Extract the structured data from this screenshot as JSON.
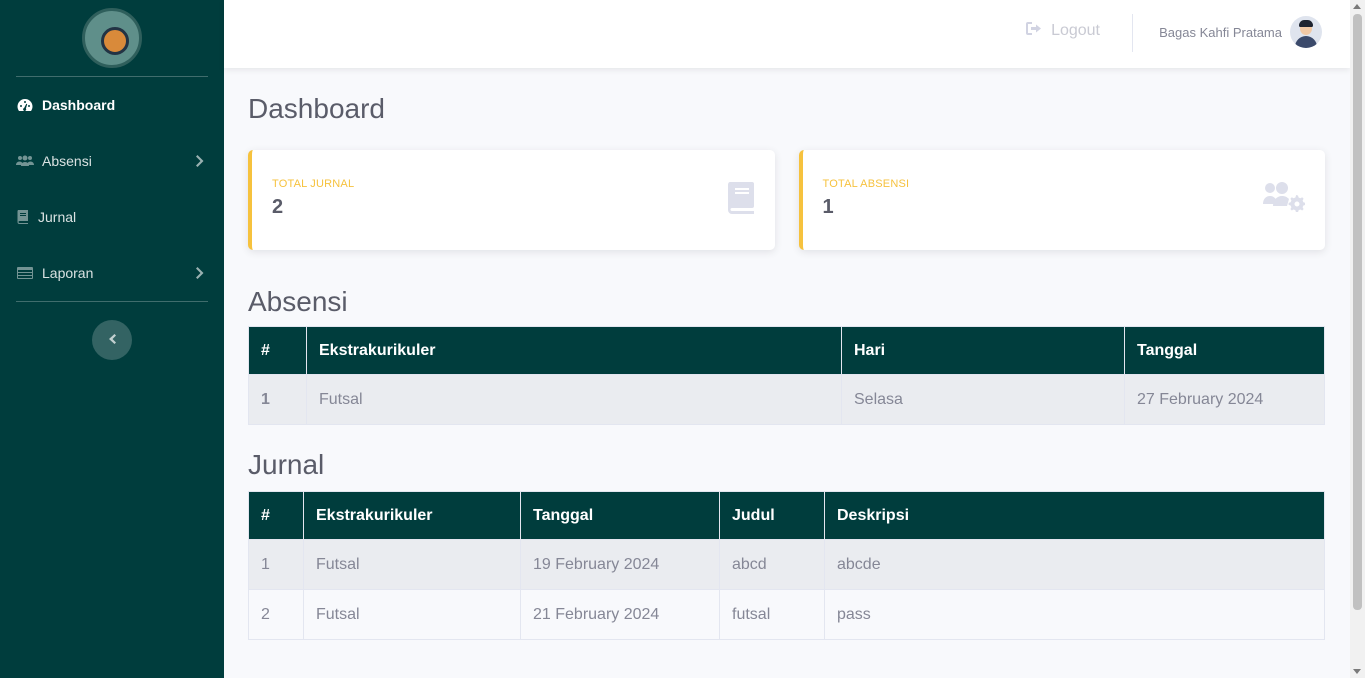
{
  "sidebar": {
    "items": [
      {
        "label": "Dashboard",
        "icon": "tachometer-icon",
        "active": true
      },
      {
        "label": "Absensi",
        "icon": "users-cog-icon",
        "has_children": true
      },
      {
        "label": "Jurnal",
        "icon": "book-icon"
      },
      {
        "label": "Laporan",
        "icon": "table-icon",
        "has_children": true
      }
    ]
  },
  "topbar": {
    "logout_label": "Logout",
    "user_name": "Bagas Kahfi Pratama"
  },
  "page": {
    "title": "Dashboard"
  },
  "cards": [
    {
      "label": "TOTAL JURNAL",
      "value": "2",
      "icon": "book-icon"
    },
    {
      "label": "TOTAL ABSENSI",
      "value": "1",
      "icon": "users-cog-icon"
    }
  ],
  "absensi": {
    "title": "Absensi",
    "headers": [
      "#",
      "Ekstrakurikuler",
      "Hari",
      "Tanggal"
    ],
    "rows": [
      [
        "1",
        "Futsal",
        "Selasa",
        "27 February 2024"
      ]
    ]
  },
  "jurnal": {
    "title": "Jurnal",
    "headers": [
      "#",
      "Ekstrakurikuler",
      "Tanggal",
      "Judul",
      "Deskripsi"
    ],
    "rows": [
      [
        "1",
        "Futsal",
        "19 February 2024",
        "abcd",
        "abcde"
      ],
      [
        "2",
        "Futsal",
        "21 February 2024",
        "futsal",
        "pass"
      ]
    ]
  },
  "colors": {
    "sidebar": "#003d3d",
    "accent": "#f6c23e",
    "table_header": "#003d3d"
  }
}
